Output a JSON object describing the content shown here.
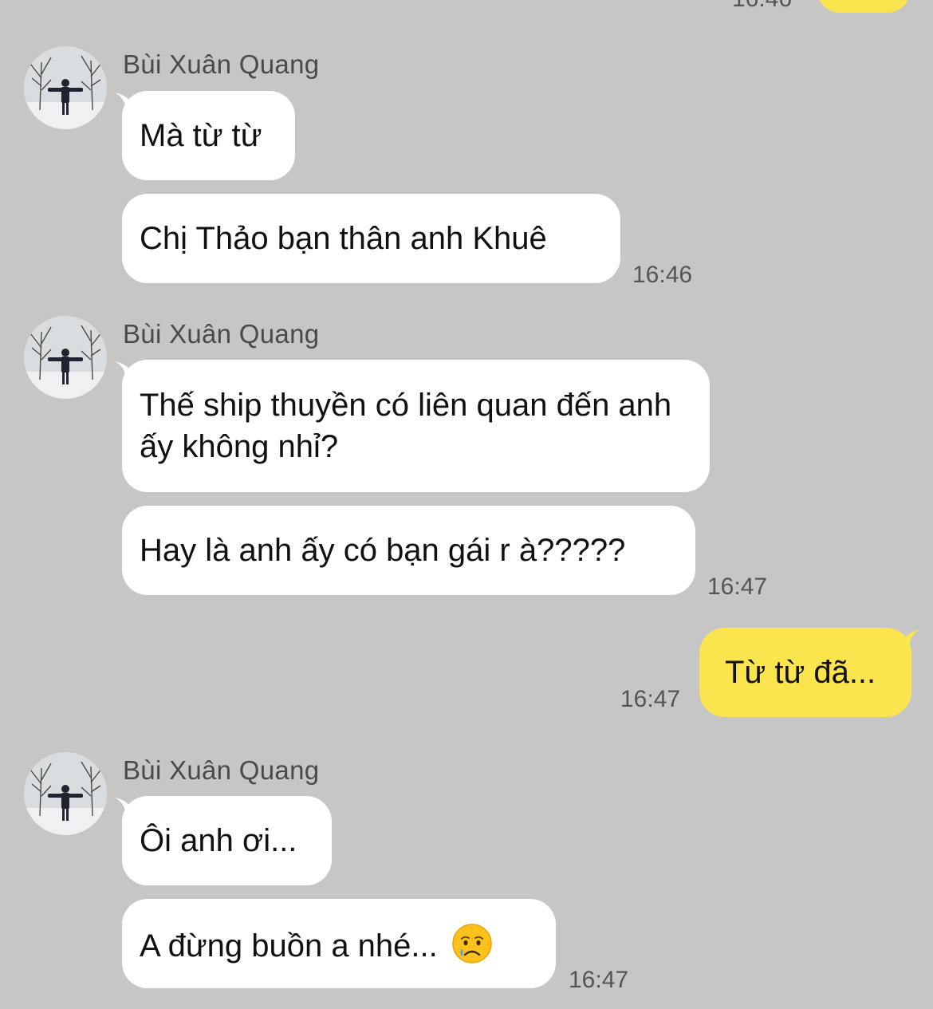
{
  "top_partial": {
    "time": "16:46"
  },
  "groups": [
    {
      "sender": "Bùi Xuân Quang",
      "messages": [
        "Mà từ từ",
        "Chị Thảo bạn thân anh Khuê"
      ],
      "time": "16:46"
    },
    {
      "sender": "Bùi Xuân Quang",
      "messages": [
        "Thế ship thuyền có liên quan đến anh ấy không nhỉ?",
        "Hay là anh ấy có bạn gái r à?????"
      ],
      "time": "16:47"
    },
    {
      "sender": "Bùi Xuân Quang",
      "messages": [
        "Ôi anh ơi...",
        "A đừng buồn a nhé..."
      ],
      "time": "16:47",
      "emoji": "crying-face"
    }
  ],
  "mine": {
    "message": "Từ từ đã...",
    "time": "16:47"
  },
  "colors": {
    "background": "#c6c6c6",
    "incoming_bubble": "#ffffff",
    "outgoing_bubble": "#fbe54e"
  }
}
